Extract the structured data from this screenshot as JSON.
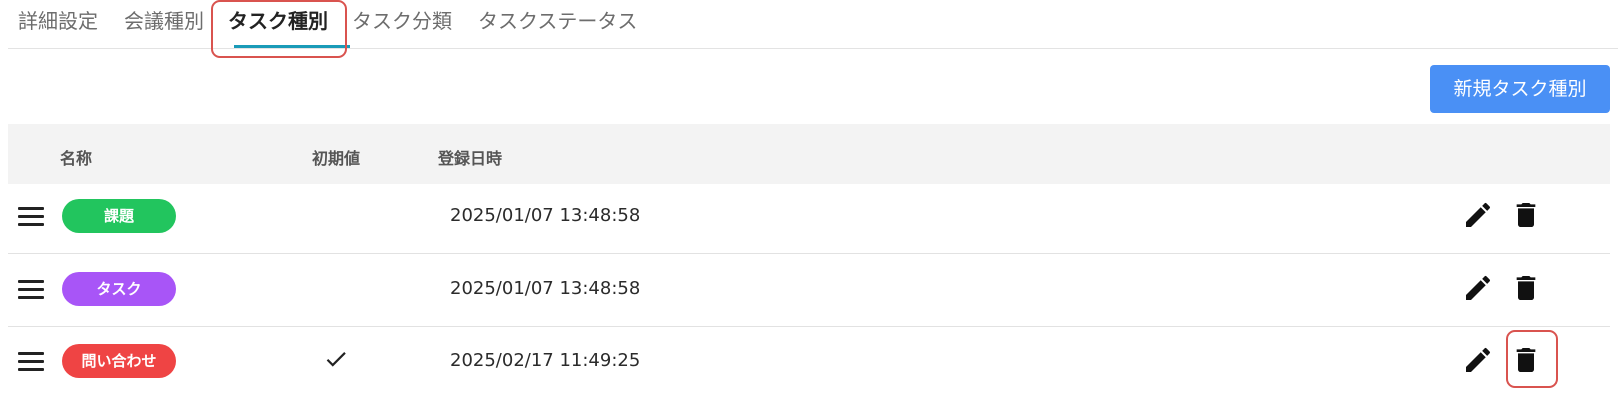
{
  "tabs": [
    {
      "label": "詳細設定"
    },
    {
      "label": "会議種別"
    },
    {
      "label": "タスク種別",
      "active": true
    },
    {
      "label": "タスク分類"
    },
    {
      "label": "タスクステータス"
    }
  ],
  "toolbar": {
    "new_button_label": "新規タスク種別"
  },
  "table": {
    "headers": {
      "name": "名称",
      "default": "初期値",
      "registered_at": "登録日時"
    },
    "rows": [
      {
        "name": "課題",
        "color": "#22c55e",
        "is_default": false,
        "registered_at": "2025/01/07 13:48:58"
      },
      {
        "name": "タスク",
        "color": "#a855f7",
        "is_default": false,
        "registered_at": "2025/01/07 13:48:58"
      },
      {
        "name": "問い合わせ",
        "color": "#ef4444",
        "is_default": true,
        "registered_at": "2025/02/17 11:49:25"
      }
    ]
  },
  "icons": {
    "drag": "drag-handle-icon",
    "edit": "pencil-icon",
    "delete": "trash-icon",
    "check": "checkmark-icon"
  },
  "colors": {
    "accent": "#4a90f5",
    "tab_underline": "#1a9bb8",
    "highlight": "#d9534f"
  }
}
